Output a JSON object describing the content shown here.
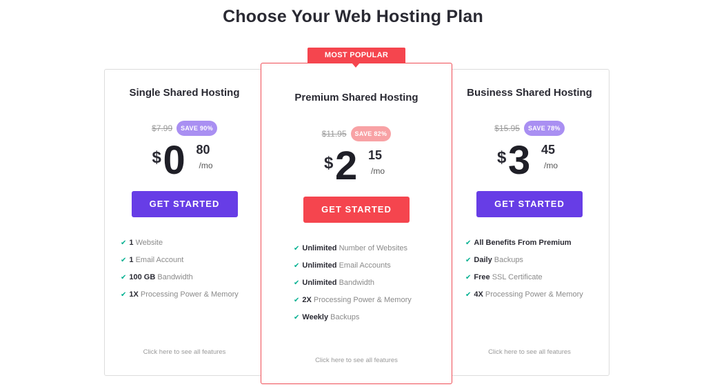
{
  "page": {
    "title": "Choose Your Web Hosting Plan"
  },
  "colors": {
    "purple": "#673de6",
    "red": "#f5454e",
    "save_purple": "#a98ff2",
    "save_pink": "#f8a2a5",
    "check_green": "#00b090"
  },
  "plans": [
    {
      "name": "Single Shared Hosting",
      "old_price": "$7.99",
      "save": "SAVE 90%",
      "currency": "$",
      "dollars": "0",
      "cents": "80",
      "period": "/mo",
      "cta": "GET STARTED",
      "features": [
        {
          "bold": "1",
          "text": " Website"
        },
        {
          "bold": "1",
          "text": " Email Account"
        },
        {
          "bold": "100 GB",
          "text": " Bandwidth"
        },
        {
          "bold": "1X",
          "text": " Processing Power & Memory"
        }
      ],
      "see_all": "Click here to see all features"
    },
    {
      "badge": "MOST POPULAR",
      "name": "Premium Shared Hosting",
      "old_price": "$11.95",
      "save": "SAVE 82%",
      "currency": "$",
      "dollars": "2",
      "cents": "15",
      "period": "/mo",
      "cta": "GET STARTED",
      "features": [
        {
          "bold": "Unlimited",
          "text": " Number of Websites"
        },
        {
          "bold": "Unlimited",
          "text": " Email Accounts"
        },
        {
          "bold": "Unlimited",
          "text": " Bandwidth"
        },
        {
          "bold": "2X",
          "text": " Processing Power & Memory"
        },
        {
          "bold": "Weekly",
          "text": " Backups"
        }
      ],
      "see_all": "Click here to see all features"
    },
    {
      "name": "Business Shared Hosting",
      "old_price": "$15.95",
      "save": "SAVE 78%",
      "currency": "$",
      "dollars": "3",
      "cents": "45",
      "period": "/mo",
      "cta": "GET STARTED",
      "features": [
        {
          "bold": "All Benefits From Premium",
          "text": ""
        },
        {
          "bold": "Daily",
          "text": " Backups"
        },
        {
          "bold": "Free",
          "text": " SSL Certificate"
        },
        {
          "bold": "4X",
          "text": " Processing Power & Memory"
        }
      ],
      "see_all": "Click here to see all features"
    }
  ]
}
